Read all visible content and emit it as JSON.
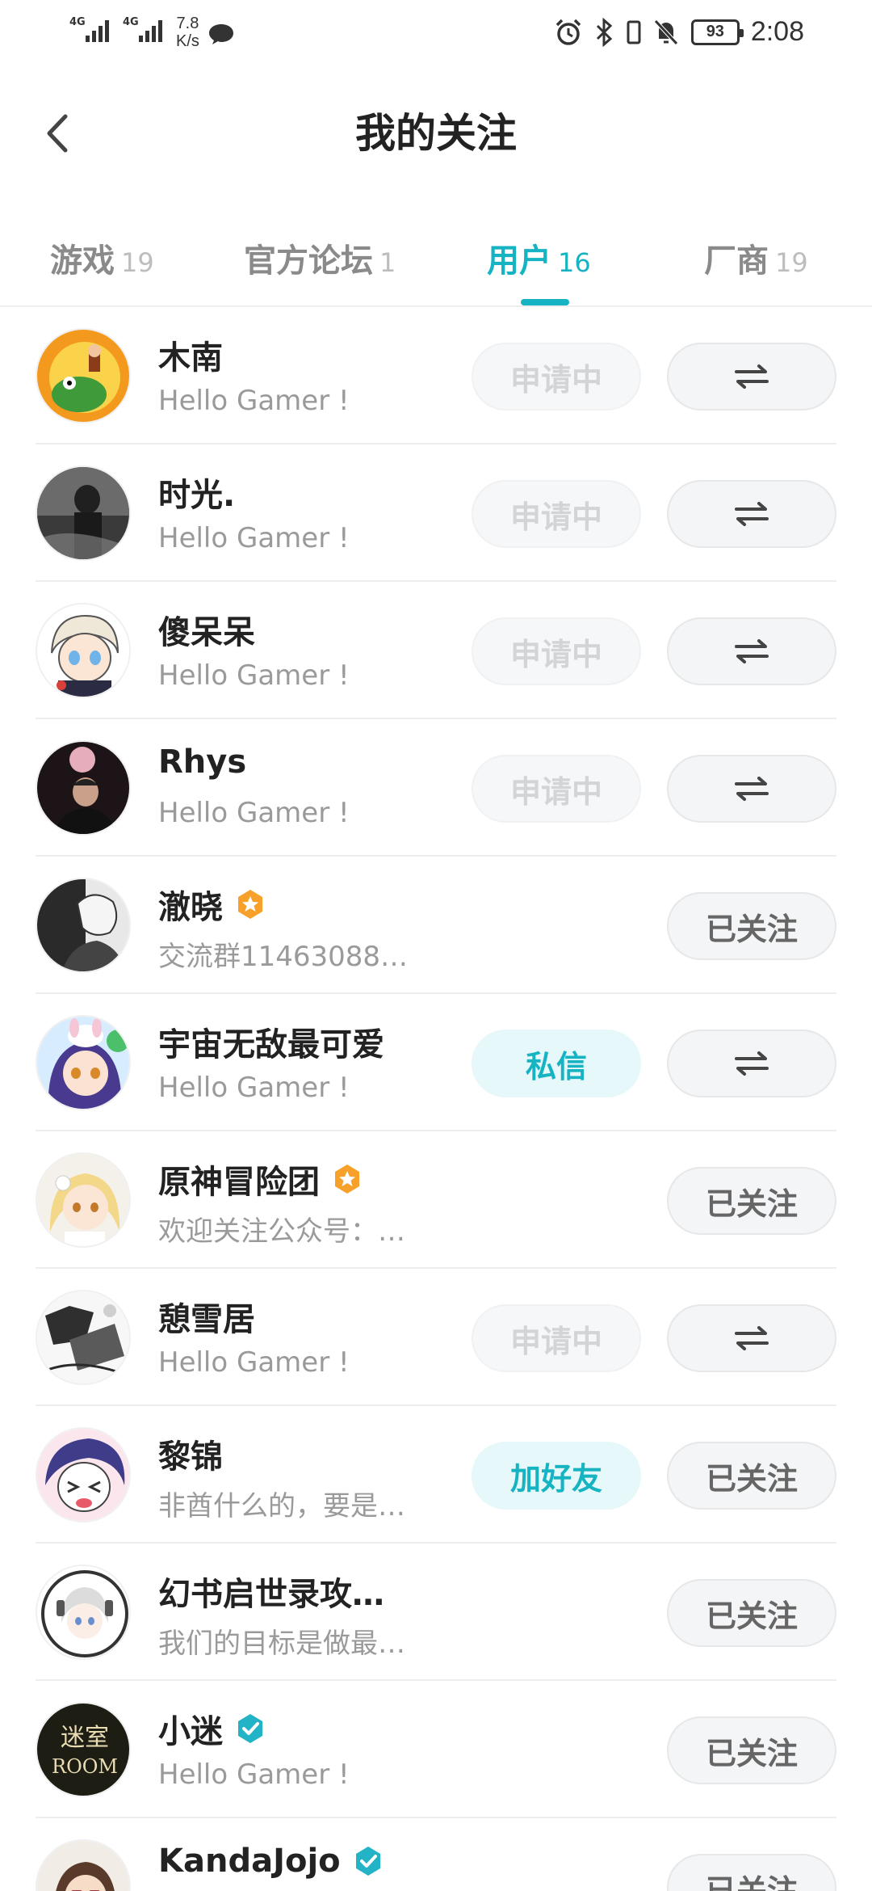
{
  "status_bar": {
    "net1": "4G",
    "net2": "4G",
    "speed_value": "7.8",
    "speed_unit": "K/s",
    "battery": "93",
    "time": "2:08"
  },
  "header": {
    "title": "我的关注"
  },
  "tabs": [
    {
      "label": "游戏",
      "count": "19"
    },
    {
      "label": "官方论坛",
      "count": "1"
    },
    {
      "label": "用户",
      "count": "16"
    },
    {
      "label": "厂商",
      "count": "19"
    }
  ],
  "active_tab": "用户",
  "accent_color": "#16b3c2",
  "users": [
    {
      "name": "木南",
      "bio": "Hello Gamer !",
      "badge": "",
      "left_button": "申请中",
      "right_button": "⇌"
    },
    {
      "name": "时光.",
      "bio": "Hello Gamer !",
      "badge": "",
      "left_button": "申请中",
      "right_button": "⇌"
    },
    {
      "name": "傻呆呆",
      "bio": "Hello Gamer !",
      "badge": "",
      "left_button": "申请中",
      "right_button": "⇌"
    },
    {
      "name": "Rhys",
      "bio": "Hello Gamer !",
      "badge": "",
      "left_button": "申请中",
      "right_button": "⇌"
    },
    {
      "name": "澈晓",
      "bio": "交流群11463088…",
      "badge": "orange-star-badge",
      "left_button": "",
      "right_button": "已关注"
    },
    {
      "name": "宇宙无敌最可爱",
      "bio": "Hello Gamer !",
      "badge": "",
      "left_button": "私信",
      "right_button": "⇌"
    },
    {
      "name": "原神冒险团",
      "bio": "欢迎关注公众号：…",
      "badge": "orange-star-badge",
      "left_button": "",
      "right_button": "已关注"
    },
    {
      "name": "憩雪居",
      "bio": "Hello Gamer !",
      "badge": "",
      "left_button": "申请中",
      "right_button": "⇌"
    },
    {
      "name": "黎锦",
      "bio": "非酋什么的，要是…",
      "badge": "",
      "left_button": "加好友",
      "right_button": "已关注"
    },
    {
      "name": "幻书启世录攻…",
      "bio": "我们的目标是做最…",
      "badge": "",
      "left_button": "",
      "right_button": "已关注"
    },
    {
      "name": "小迷",
      "bio": "Hello Gamer !",
      "badge": "teal-check-badge",
      "left_button": "",
      "right_button": "已关注",
      "avatar_text_1": "迷室",
      "avatar_text_2": "ROOM"
    },
    {
      "name": "KandaJojo",
      "bio": "",
      "badge": "teal-check-badge",
      "left_button": "",
      "right_button": "已关注"
    }
  ]
}
